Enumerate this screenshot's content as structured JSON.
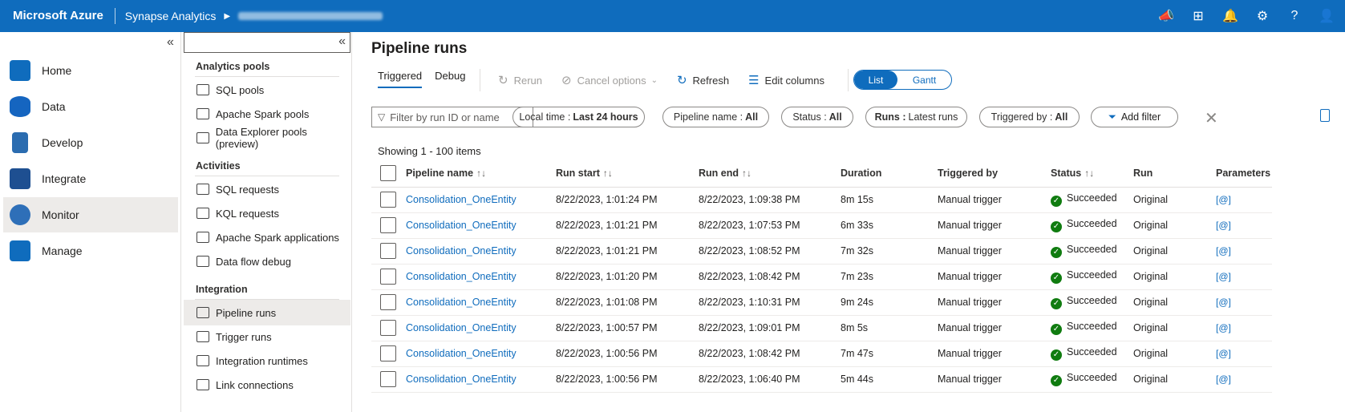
{
  "topbar": {
    "brand": "Microsoft Azure",
    "service": "Synapse Analytics",
    "icons": [
      "feedback-icon",
      "directory-icon",
      "notifications-icon",
      "settings-icon",
      "help-icon",
      "account-icon"
    ]
  },
  "leftnav": {
    "items": [
      {
        "label": "Home",
        "icon": "home-icon"
      },
      {
        "label": "Data",
        "icon": "data-icon"
      },
      {
        "label": "Develop",
        "icon": "develop-icon"
      },
      {
        "label": "Integrate",
        "icon": "integrate-icon"
      },
      {
        "label": "Monitor",
        "icon": "monitor-icon",
        "active": true
      },
      {
        "label": "Manage",
        "icon": "manage-icon"
      }
    ]
  },
  "subnav": {
    "sections": [
      {
        "title": "Analytics pools",
        "items": [
          "SQL pools",
          "Apache Spark pools",
          "Data Explorer pools (preview)"
        ]
      },
      {
        "title": "Activities",
        "items": [
          "SQL requests",
          "KQL requests",
          "Apache Spark applications",
          "Data flow debug"
        ]
      },
      {
        "title": "Integration",
        "items": [
          "Pipeline runs",
          "Trigger runs",
          "Integration runtimes",
          "Link connections"
        ]
      }
    ],
    "active": "Pipeline runs"
  },
  "main": {
    "title": "Pipeline runs",
    "tabs": [
      "Triggered",
      "Debug"
    ],
    "toolbar": {
      "rerun": "Rerun",
      "cancel": "Cancel options",
      "refresh": "Refresh",
      "edit_columns": "Edit columns"
    },
    "view_toggle": {
      "list": "List",
      "gantt": "Gantt"
    },
    "filter_placeholder": "Filter by run ID or name",
    "pills": {
      "time_key": "Local time :",
      "time_val": "Last 24 hours",
      "pipeline_key": "Pipeline name :",
      "pipeline_val": "All",
      "status_key": "Status :",
      "status_val": "All",
      "runs_key": "Runs :",
      "runs_val": "Latest runs",
      "trigger_key": "Triggered by :",
      "trigger_val": "All",
      "add_filter": "Add filter"
    },
    "showing": "Showing 1 - 100 items",
    "columns": [
      "Pipeline name",
      "Run start",
      "Run end",
      "Duration",
      "Triggered by",
      "Status",
      "Run",
      "Parameters"
    ],
    "rows": [
      {
        "name": "Consolidation_OneEntity",
        "start": "8/22/2023, 1:01:24 PM",
        "end": "8/22/2023, 1:09:38 PM",
        "duration": "8m 15s",
        "trigger": "Manual trigger",
        "status": "Succeeded",
        "run": "Original",
        "param": "[@]"
      },
      {
        "name": "Consolidation_OneEntity",
        "start": "8/22/2023, 1:01:21 PM",
        "end": "8/22/2023, 1:07:53 PM",
        "duration": "6m 33s",
        "trigger": "Manual trigger",
        "status": "Succeeded",
        "run": "Original",
        "param": "[@]"
      },
      {
        "name": "Consolidation_OneEntity",
        "start": "8/22/2023, 1:01:21 PM",
        "end": "8/22/2023, 1:08:52 PM",
        "duration": "7m 32s",
        "trigger": "Manual trigger",
        "status": "Succeeded",
        "run": "Original",
        "param": "[@]"
      },
      {
        "name": "Consolidation_OneEntity",
        "start": "8/22/2023, 1:01:20 PM",
        "end": "8/22/2023, 1:08:42 PM",
        "duration": "7m 23s",
        "trigger": "Manual trigger",
        "status": "Succeeded",
        "run": "Original",
        "param": "[@]"
      },
      {
        "name": "Consolidation_OneEntity",
        "start": "8/22/2023, 1:01:08 PM",
        "end": "8/22/2023, 1:10:31 PM",
        "duration": "9m 24s",
        "trigger": "Manual trigger",
        "status": "Succeeded",
        "run": "Original",
        "param": "[@]"
      },
      {
        "name": "Consolidation_OneEntity",
        "start": "8/22/2023, 1:00:57 PM",
        "end": "8/22/2023, 1:09:01 PM",
        "duration": "8m 5s",
        "trigger": "Manual trigger",
        "status": "Succeeded",
        "run": "Original",
        "param": "[@]"
      },
      {
        "name": "Consolidation_OneEntity",
        "start": "8/22/2023, 1:00:56 PM",
        "end": "8/22/2023, 1:08:42 PM",
        "duration": "7m 47s",
        "trigger": "Manual trigger",
        "status": "Succeeded",
        "run": "Original",
        "param": "[@]"
      },
      {
        "name": "Consolidation_OneEntity",
        "start": "8/22/2023, 1:00:56 PM",
        "end": "8/22/2023, 1:06:40 PM",
        "duration": "5m 44s",
        "trigger": "Manual trigger",
        "status": "Succeeded",
        "run": "Original",
        "param": "[@]"
      }
    ]
  },
  "colors": {
    "accent": "#0f6cbd",
    "success": "#107c10",
    "topbar": "#0f6cbd"
  }
}
